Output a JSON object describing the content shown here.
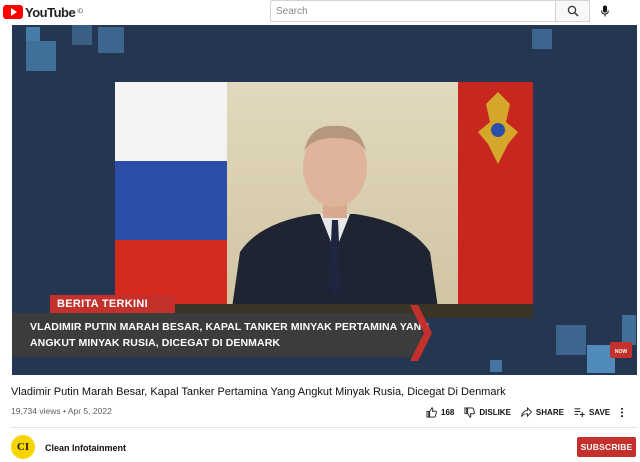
{
  "header": {
    "logo_text": "YouTube",
    "logo_sup": "ID",
    "search_placeholder": "Search",
    "icons": [
      "youtube-logo-icon",
      "search-icon",
      "mic-icon"
    ]
  },
  "video": {
    "badge": "BERITA TERKINI",
    "headline_lines": [
      "VLADIMIR PUTIN MARAH BESAR, KAPAL TANKER MINYAK PERTAMINA YANG",
      "ANGKUT MINYAK RUSIA, DICEGAT DI DENMARK"
    ],
    "corner_logo": "NOW",
    "colors": {
      "background": "#243652",
      "accent_squares": "#4d87b7",
      "badge_red": "#c4302b",
      "headline_bar": "#3d3c3d"
    }
  },
  "info": {
    "title": "Vladimir Putin Marah Besar, Kapal Tanker Pertamina Yang Angkut Minyak Rusia, Dicegat Di Denmark",
    "meta": "19,734 views • Apr 5, 2022",
    "actions": {
      "like_count": "168",
      "dislike_label": "DISLIKE",
      "share_label": "SHARE",
      "save_label": "SAVE"
    }
  },
  "channel": {
    "avatar_text": "CI",
    "name": "Clean Infotainment",
    "subscribe_label": "SUBSCRIBE"
  }
}
